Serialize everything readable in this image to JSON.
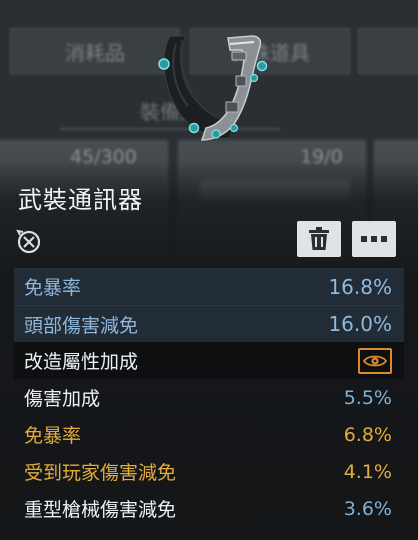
{
  "background": {
    "tabs": [
      "消耗品",
      "特殊道具",
      ""
    ],
    "subtab": "裝備庫",
    "counts": [
      "45/300",
      "19/0"
    ]
  },
  "item": {
    "title": "武裝通訊器",
    "icon": "armored-communicator-icon"
  },
  "actions": {
    "delete_icon": "trash-icon",
    "more_icon": "ellipsis-icon"
  },
  "base_stats": [
    {
      "label": "免暴率",
      "value": "16.8%"
    },
    {
      "label": "頭部傷害減免",
      "value": "16.0%"
    }
  ],
  "mod_section": {
    "header": "改造屬性加成",
    "toggle_icon": "eye-icon"
  },
  "mod_stats": [
    {
      "label": "傷害加成",
      "value": "5.5%",
      "tier": "normal"
    },
    {
      "label": "免暴率",
      "value": "6.8%",
      "tier": "gold"
    },
    {
      "label": "受到玩家傷害減免",
      "value": "4.1%",
      "tier": "gold"
    },
    {
      "label": "重型槍械傷害減免",
      "value": "3.6%",
      "tier": "normal"
    }
  ],
  "colors": {
    "accent_gold": "#e3ad3a",
    "accent_blue": "#8fb8dc",
    "eye_orange": "#d98a2b"
  }
}
